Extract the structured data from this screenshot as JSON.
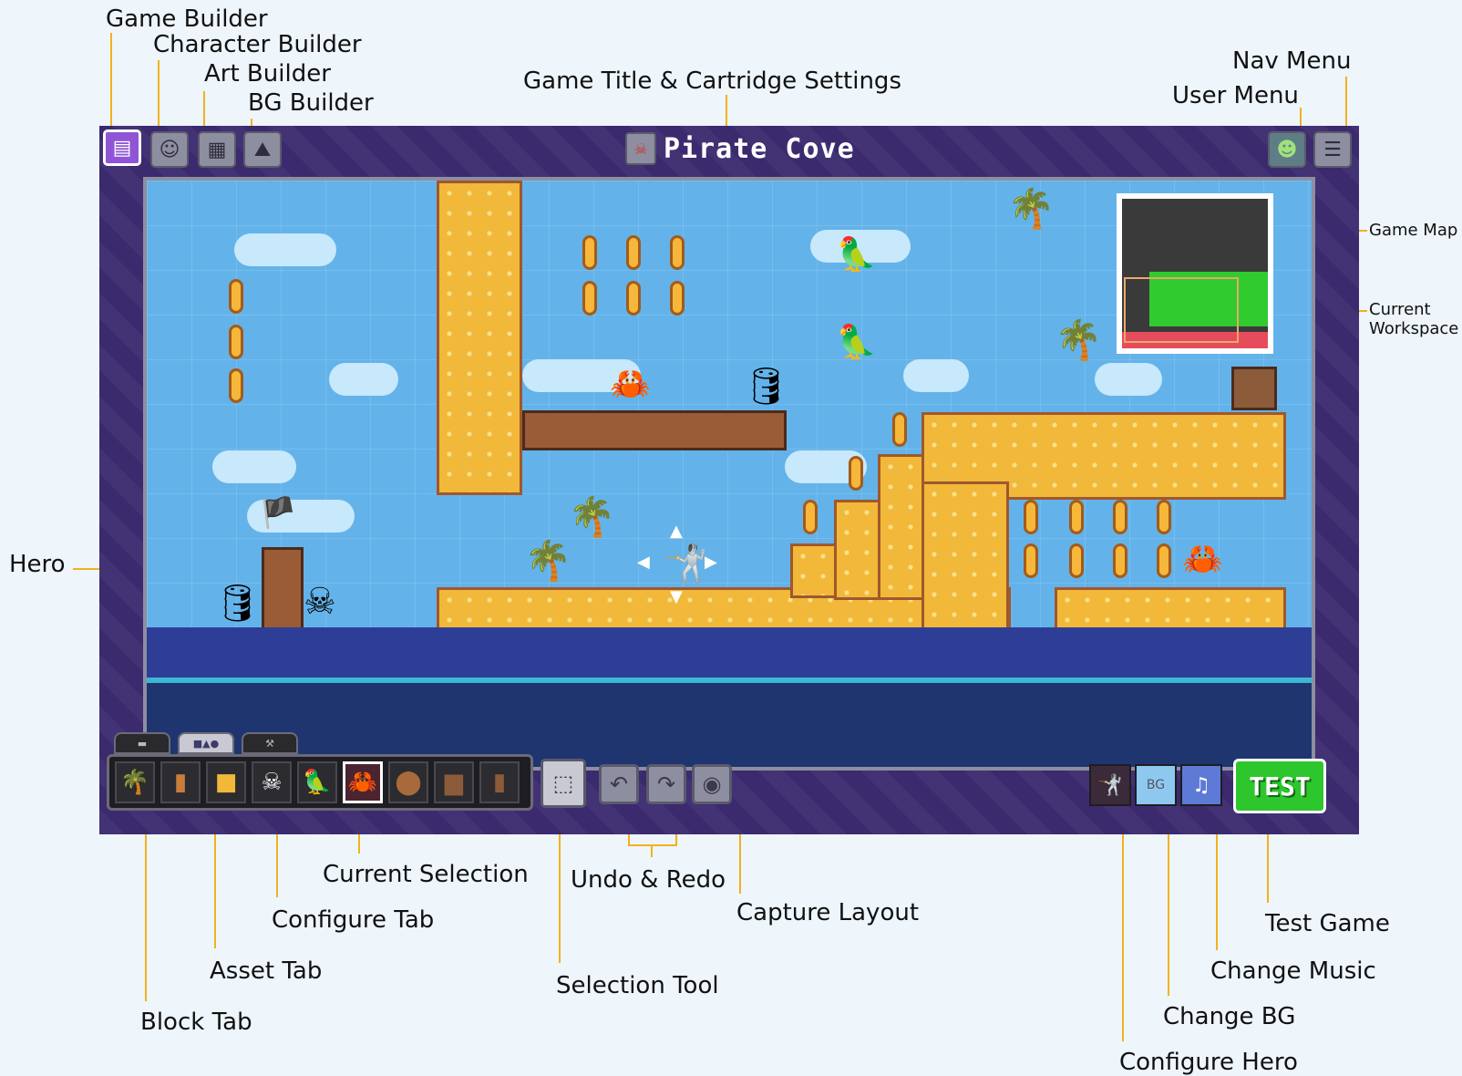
{
  "annotations": {
    "game_builder": "Game Builder",
    "character_builder": "Character Builder",
    "art_builder": "Art Builder",
    "bg_builder": "BG Builder",
    "game_title_settings": "Game Title & Cartridge Settings",
    "nav_menu": "Nav Menu",
    "user_menu": "User Menu",
    "game_map": "Game Map",
    "current_workspace": "Current Workspace",
    "hero": "Hero",
    "current_selection": "Current Selection",
    "configure_tab": "Configure Tab",
    "asset_tab": "Asset Tab",
    "block_tab": "Block Tab",
    "selection_tool": "Selection Tool",
    "undo_redo": "Undo & Redo",
    "capture_layout": "Capture Layout",
    "test_game": "Test Game",
    "change_music": "Change Music",
    "change_bg": "Change BG",
    "configure_hero": "Configure Hero"
  },
  "header": {
    "game_title": "Pirate Cove",
    "builder_icons": [
      "game-builder-icon",
      "character-builder-icon",
      "art-builder-icon",
      "bg-builder-icon"
    ]
  },
  "toolbar": {
    "test_label": "TEST",
    "palette": [
      "palm-tree",
      "wood-post",
      "sand-block",
      "pirate",
      "parrot",
      "crab",
      "barrel",
      "crate",
      "pillar"
    ],
    "selected_index": 5
  },
  "colors": {
    "frame": "#3b2a6e",
    "sky": "#63b3ea",
    "sand": "#f2b83a",
    "accent": "#f2b21b",
    "test_green": "#2dc62d"
  }
}
